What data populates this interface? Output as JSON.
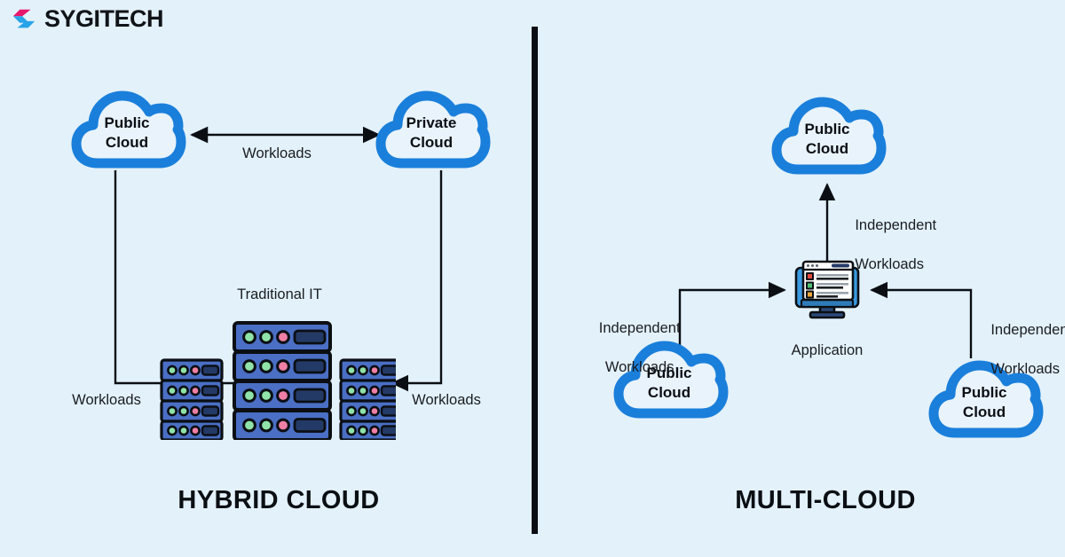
{
  "brand": {
    "name": "SYGITECH",
    "mark_colors": {
      "top": "#e8176b",
      "bottom": "#29a3e8"
    },
    "text_color": "#101418"
  },
  "canvas": {
    "background": "#e3f1fa",
    "divider_color": "#0b0f14",
    "cloud_stroke": "#1a7fdb",
    "cloud_fill": "#e9f3fb",
    "arrow_color": "#0b0f14",
    "server_body": "#4a6fc4",
    "server_outline": "#0b0f14",
    "server_slot": "#243a66",
    "led_green": "#8fe3a8",
    "led_pink": "#ef7fa5",
    "monitor_bezel": "#3b9ae1",
    "monitor_screen": "#ffffff",
    "monitor_stand": "#2b4a7a"
  },
  "panels": [
    {
      "id": "hybrid",
      "title": "HYBRID CLOUD",
      "clouds": [
        {
          "id": "public",
          "line1": "Public",
          "line2": "Cloud"
        },
        {
          "id": "private",
          "line1": "Private",
          "line2": "Cloud"
        }
      ],
      "center_label": "Traditional IT",
      "edges": [
        {
          "id": "between-clouds",
          "label": "Workloads",
          "direction": "bidirectional"
        },
        {
          "id": "public-to-it",
          "label": "Workloads",
          "direction": "down-right"
        },
        {
          "id": "private-to-it",
          "label": "Workloads",
          "direction": "down-left"
        }
      ]
    },
    {
      "id": "multicloud",
      "title": "MULTI-CLOUD",
      "app_label": "Application",
      "clouds": [
        {
          "id": "top",
          "line1": "Public",
          "line2": "Cloud"
        },
        {
          "id": "bottom-left",
          "line1": "Public",
          "line2": "Cloud"
        },
        {
          "id": "bottom-right",
          "line1": "Public",
          "line2": "Cloud"
        }
      ],
      "edges": [
        {
          "id": "app-to-top",
          "label_line1": "Independent",
          "label_line2": "Workloads",
          "direction": "up"
        },
        {
          "id": "left-to-app",
          "label_line1": "Independent",
          "label_line2": "Workloads",
          "direction": "right"
        },
        {
          "id": "right-to-app",
          "label_line1": "Independent",
          "label_line2": "Workloads",
          "direction": "left"
        }
      ]
    }
  ]
}
